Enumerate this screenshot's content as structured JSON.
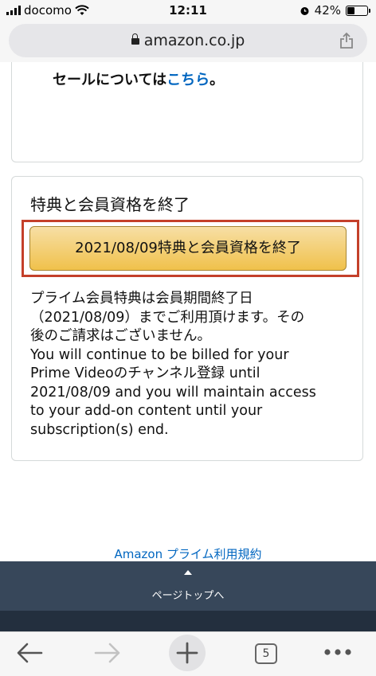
{
  "status_bar": {
    "carrier": "docomo",
    "time": "12:11",
    "battery_percent": "42%",
    "battery_level": 0.42
  },
  "browser": {
    "url": "amazon.co.jp",
    "tab_count": "5"
  },
  "sale_note": {
    "text": "セールについては",
    "link": "こちら",
    "suffix": "。"
  },
  "end_membership": {
    "title": "特典と会員資格を終了",
    "button_label": "2021/08/09特典と会員資格を終了",
    "desc_lines": [
      "プライム会員特典は会員期間終了日",
      "（2021/08/09）までご利用頂けます。その",
      "後のご請求はございません。",
      "You will continue to be billed for your",
      "Prime Videoのチャンネル登録 until",
      "2021/08/09 and you will maintain access",
      "to your add-on content until your",
      "subscription(s) end."
    ]
  },
  "footer": {
    "terms_link": "Amazon プライム利用規約",
    "page_top": "ページトップへ"
  },
  "colors": {
    "button_top": "#f7dfa5",
    "button_bottom": "#f0c14b",
    "focus_outline": "#c4402a",
    "link": "#0066c0",
    "pagetop_bg": "#37475a"
  }
}
